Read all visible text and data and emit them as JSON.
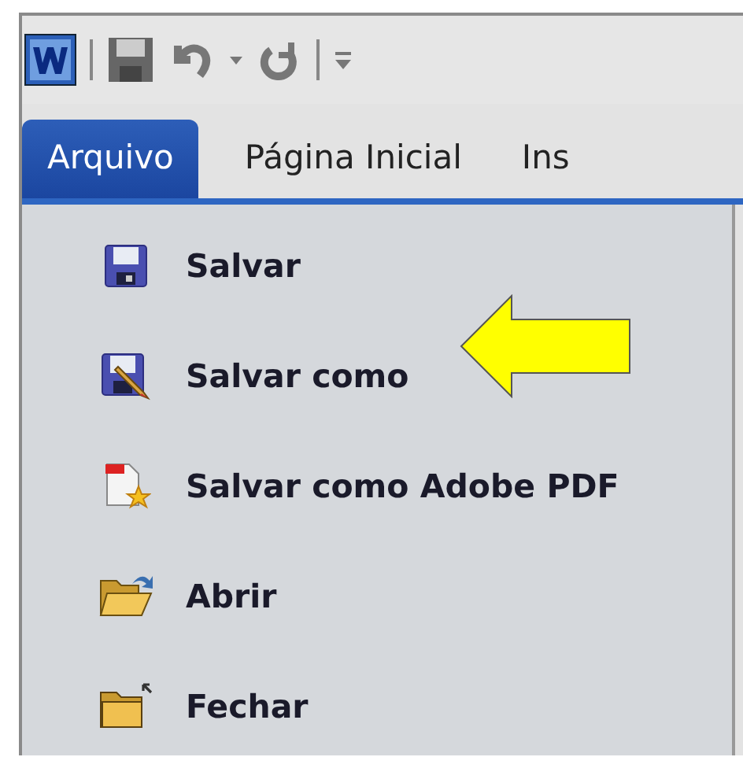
{
  "tabs": [
    {
      "label": "Arquivo",
      "selected": true
    },
    {
      "label": "Página Inicial",
      "selected": false
    },
    {
      "label": "Ins",
      "selected": false
    }
  ],
  "menu": [
    {
      "label": "Salvar",
      "kind": "save",
      "arrow": false
    },
    {
      "label": "Salvar como",
      "kind": "save-as",
      "arrow": true
    },
    {
      "label": "Salvar como Adobe PDF",
      "kind": "pdf",
      "arrow": false
    },
    {
      "label": "Abrir",
      "kind": "open",
      "arrow": false
    },
    {
      "label": "Fechar",
      "kind": "close",
      "arrow": false
    }
  ]
}
